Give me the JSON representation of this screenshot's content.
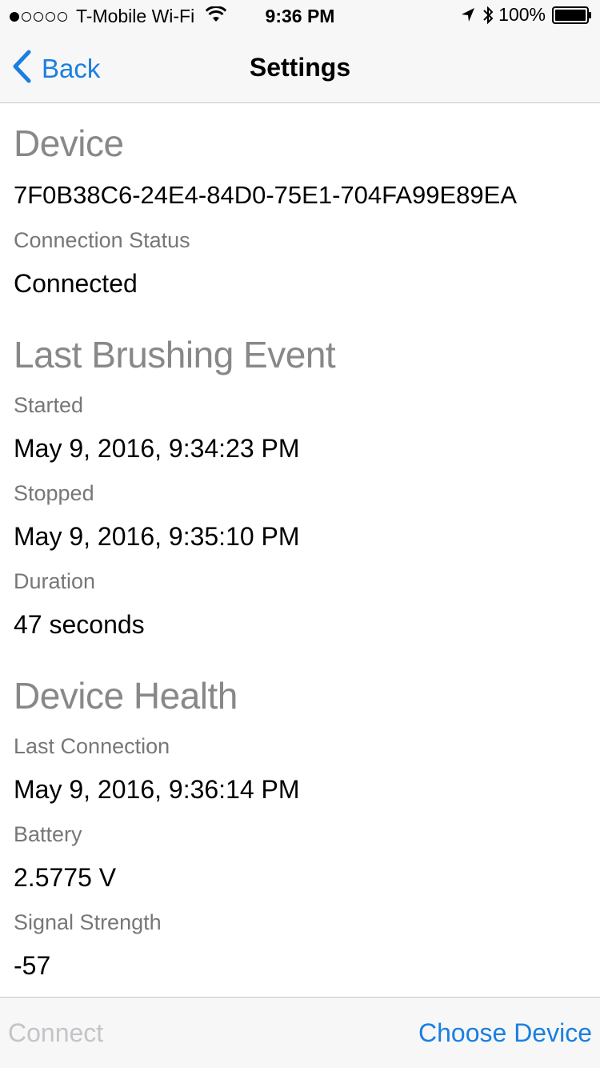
{
  "status_bar": {
    "carrier": "T-Mobile Wi-Fi",
    "time": "9:36 PM",
    "battery_percent": "100%",
    "signal_dots_filled": 1,
    "signal_dots_total": 5,
    "icons": [
      "wifi-icon",
      "location-arrow-icon",
      "bluetooth-icon",
      "battery-icon"
    ]
  },
  "nav": {
    "back_label": "Back",
    "title": "Settings"
  },
  "device": {
    "section_title": "Device",
    "id": "7F0B38C6-24E4-84D0-75E1-704FA99E89EA",
    "connection_status_label": "Connection Status",
    "connection_status_value": "Connected"
  },
  "brushing": {
    "section_title": "Last Brushing Event",
    "started_label": "Started",
    "started_value": "May 9, 2016, 9:34:23 PM",
    "stopped_label": "Stopped",
    "stopped_value": "May 9, 2016, 9:35:10 PM",
    "duration_label": "Duration",
    "duration_value": "47 seconds"
  },
  "health": {
    "section_title": "Device Health",
    "last_connection_label": "Last Connection",
    "last_connection_value": "May 9, 2016, 9:36:14 PM",
    "battery_label": "Battery",
    "battery_value": "2.5775 V",
    "signal_label": "Signal Strength",
    "signal_value": "-57"
  },
  "toolbar": {
    "connect_label": "Connect",
    "choose_device_label": "Choose Device"
  },
  "colors": {
    "accent": "#1a7fe0",
    "disabled": "#c4c4c8",
    "section_title": "#888888",
    "label": "#777777"
  }
}
